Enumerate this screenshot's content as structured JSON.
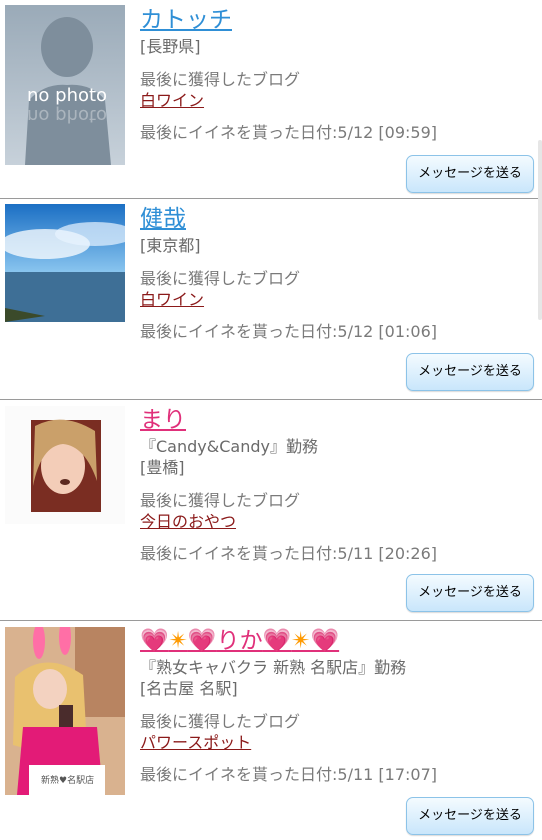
{
  "posts": [
    {
      "name": "カトッチ",
      "prefecture": "[長野県]",
      "blog_label": "最後に獲得したブログ",
      "blog_title": "白ワイン",
      "like_label": "最後にイイネを貰った日付:5/12 [09:59]",
      "button": "メッセージを送る",
      "photo_text": "no photo"
    },
    {
      "name": "健哉",
      "prefecture": "[東京都]",
      "blog_label": "最後に獲得したブログ",
      "blog_title": "白ワイン",
      "like_label": "最後にイイネを貰った日付:5/12 [01:06]",
      "button": "メッセージを送る"
    },
    {
      "name": "まり",
      "shop": "『Candy&Candy』勤務",
      "prefecture": "[豊橋]",
      "blog_label": "最後に獲得したブログ",
      "blog_title": "今日のおやつ",
      "like_label": "最後にイイネを貰った日付:5/11 [20:26]",
      "button": "メッセージを送る"
    },
    {
      "name": "りか",
      "shop": "『熟女キャバクラ 新熟 名駅店』勤務",
      "prefecture": "[名古屋 名駅]",
      "blog_label": "最後に獲得したブログ",
      "blog_title": "パワースポット",
      "like_label": "最後にイイネを貰った日付:5/11 [17:07]",
      "button": "メッセージを送る",
      "photo_text": "新熟♥名駅店"
    }
  ]
}
